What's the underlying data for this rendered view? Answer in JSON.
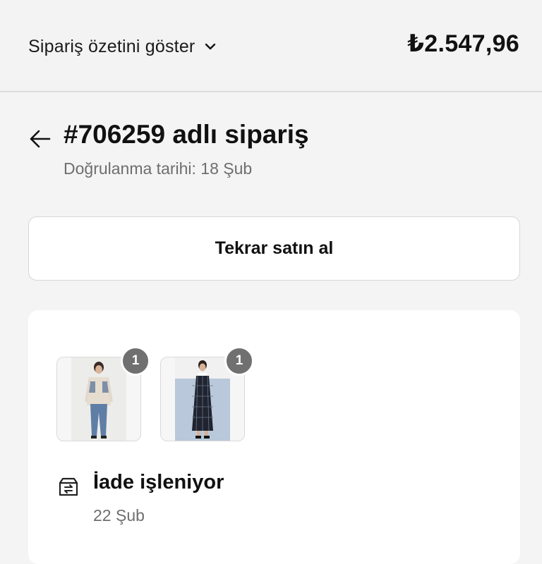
{
  "summary": {
    "toggle_label": "Sipariş özetini göster",
    "total": "₺2.547,96",
    "chevron_icon": "chevron-down-icon"
  },
  "order": {
    "back_icon": "arrow-left-icon",
    "title": "#706259 adlı sipariş",
    "confirmed": "Doğrulanma tarihi: 18 Şub"
  },
  "actions": {
    "buy_again": "Tekrar satın al"
  },
  "items": [
    {
      "name": "product-thumbnail-shirt-jeans",
      "quantity": "1"
    },
    {
      "name": "product-thumbnail-plaid-dress",
      "quantity": "1"
    }
  ],
  "status": {
    "icon": "return-box-icon",
    "title": "İade işleniyor",
    "date": "22 Şub"
  }
}
